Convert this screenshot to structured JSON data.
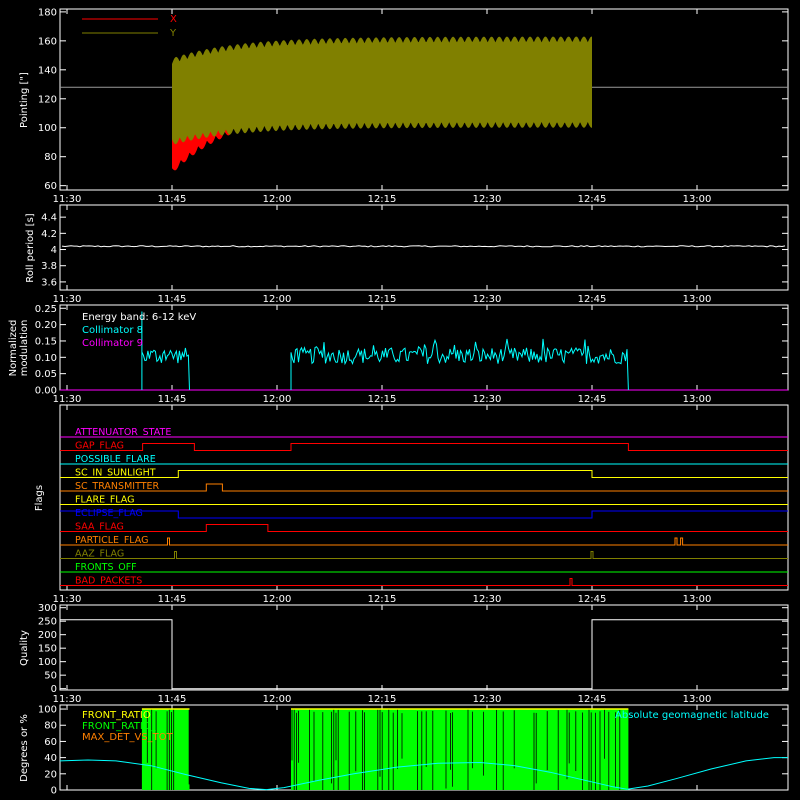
{
  "chart_data": [
    {
      "id": "pointing",
      "type": "line",
      "ylabel": "Pointing [\"]",
      "ylim": [
        57,
        182
      ],
      "yticks": [
        60,
        80,
        100,
        120,
        140,
        160,
        180
      ],
      "x_ticks": [
        "11:30",
        "11:45",
        "12:00",
        "12:15",
        "12:30",
        "12:45",
        "13:00"
      ],
      "x_tick_minutes": [
        690,
        705,
        720,
        735,
        750,
        765,
        780
      ],
      "x_range_minutes": [
        689,
        793
      ],
      "legend": {
        "placement": "top-left"
      },
      "reference_line": 128,
      "series": [
        {
          "name": "X",
          "color": "#ff0000",
          "start": 705.0,
          "end": 765.0,
          "start_range": [
            68,
            145
          ],
          "settled_range": [
            113,
            158
          ]
        },
        {
          "name": "Y",
          "color": "#808000",
          "start": 705.0,
          "end": 765.0,
          "start_range": [
            88,
            148
          ],
          "settled_range": [
            100,
            163
          ]
        }
      ]
    },
    {
      "id": "roll-period",
      "type": "line",
      "ylabel": "Roll period [s]",
      "ylim": [
        3.5,
        4.55
      ],
      "yticks": [
        3.6,
        3.8,
        4.0,
        4.2,
        4.4
      ],
      "x_ticks": [
        "11:30",
        "11:45",
        "12:00",
        "12:15",
        "12:30",
        "12:45",
        "13:00"
      ],
      "series": [
        {
          "name": "",
          "color": "#ffffff",
          "value": 4.04
        }
      ]
    },
    {
      "id": "modulation",
      "type": "line",
      "ylabel_lines": [
        "Normalized",
        "modulation"
      ],
      "ylim": [
        0,
        0.26
      ],
      "yticks": [
        0.0,
        0.05,
        0.1,
        0.15,
        0.2,
        0.25
      ],
      "ytick_labels": [
        "0.00",
        "0.05",
        "0.10",
        "0.15",
        "0.20",
        "0.25"
      ],
      "x_ticks": [
        "11:30",
        "11:45",
        "12:00",
        "12:15",
        "12:30",
        "12:45",
        "13:00"
      ],
      "annotation": "Energy band: 6-12 keV",
      "series": [
        {
          "name": "Collimator 8",
          "color": "#00ffff",
          "segments": [
            [
              700.7,
              707.5
            ],
            [
              722.0,
              770.2
            ]
          ],
          "level": 0.105
        },
        {
          "name": "Collimator 9",
          "color": "#ff00ff",
          "value": 0.0
        }
      ]
    },
    {
      "id": "flags",
      "type": "line",
      "ylabel": "Flags",
      "x_ticks": [
        "11:30",
        "11:45",
        "12:00",
        "12:15",
        "12:30",
        "12:45",
        "13:00"
      ],
      "series": [
        {
          "name": "ATTENUATOR_STATE",
          "color": "#ff00ff",
          "steps": [
            [
              689,
              0
            ]
          ]
        },
        {
          "name": "GAP_FLAG",
          "color": "#ff0000",
          "steps": [
            [
              689,
              0
            ],
            [
              700.8,
              1
            ],
            [
              708.2,
              0
            ],
            [
              722.0,
              1
            ],
            [
              770.2,
              0
            ]
          ]
        },
        {
          "name": "POSSIBLE_FLARE",
          "color": "#00ffff",
          "steps": [
            [
              689,
              0
            ]
          ]
        },
        {
          "name": "SC_IN_SUNLIGHT",
          "color": "#ffff00",
          "steps": [
            [
              689,
              0
            ],
            [
              705.9,
              1
            ],
            [
              765.0,
              0
            ]
          ]
        },
        {
          "name": "SC_TRANSMITTER",
          "color": "#ff8000",
          "steps": [
            [
              689,
              0
            ],
            [
              709.9,
              1
            ],
            [
              712.2,
              0
            ]
          ]
        },
        {
          "name": "FLARE_FLAG",
          "color": "#ffff00",
          "steps": [
            [
              689,
              0
            ]
          ]
        },
        {
          "name": "ECLIPSE_FLAG",
          "color": "#0000ff",
          "steps": [
            [
              689,
              1
            ],
            [
              705.9,
              0
            ],
            [
              765.0,
              1
            ]
          ]
        },
        {
          "name": "SAA_FLAG",
          "color": "#ff0000",
          "steps": [
            [
              689,
              0
            ],
            [
              709.9,
              1
            ],
            [
              718.7,
              0
            ]
          ]
        },
        {
          "name": "PARTICLE_FLAG",
          "color": "#ff8000",
          "spikes": [
            704.5,
            777.0,
            777.8
          ]
        },
        {
          "name": "AAZ_FLAG",
          "color": "#808000",
          "spikes": [
            705.5,
            765.0
          ]
        },
        {
          "name": "FRONTS_OFF",
          "color": "#00ff00",
          "steps": [
            [
              689,
              0
            ]
          ]
        },
        {
          "name": "BAD_PACKETS",
          "color": "#ff0000",
          "spikes": [
            762.0
          ]
        }
      ]
    },
    {
      "id": "quality",
      "type": "line",
      "ylabel": "Quality",
      "ylim": [
        -5,
        310
      ],
      "yticks": [
        0,
        50,
        100,
        150,
        200,
        250,
        300
      ],
      "x_ticks": [
        "11:30",
        "11:45",
        "12:00",
        "12:15",
        "12:30",
        "12:45",
        "13:00"
      ],
      "series": [
        {
          "name": "",
          "color": "#ffffff",
          "steps": [
            [
              689,
              255
            ],
            [
              705.0,
              0
            ],
            [
              765.0,
              255
            ]
          ]
        }
      ]
    },
    {
      "id": "ratios",
      "type": "line",
      "ylabel": "Degrees or %",
      "ylim": [
        0,
        105
      ],
      "yticks": [
        0,
        20,
        40,
        60,
        80,
        100
      ],
      "series": [
        {
          "name": "FRONT_RATIO",
          "color": "#ffff00"
        },
        {
          "name": "FRONT_RATIO_",
          "color": "#00ff00",
          "segments": [
            [
              700.7,
              707.5
            ],
            [
              722.0,
              770.2
            ]
          ]
        },
        {
          "name": "MAX_DET_VS_TOT",
          "color": "#ff8000"
        },
        {
          "name": "Absolute geomagnetic latitude",
          "color": "#00ffff",
          "points": [
            [
              689,
              36
            ],
            [
              693,
              37
            ],
            [
              697,
              36
            ],
            [
              702,
              30
            ],
            [
              707,
              19
            ],
            [
              712,
              9
            ],
            [
              716,
              2
            ],
            [
              718.5,
              0.5
            ],
            [
              721,
              3
            ],
            [
              726,
              12
            ],
            [
              731,
              20
            ],
            [
              737,
              28
            ],
            [
              743,
              33
            ],
            [
              749,
              34
            ],
            [
              754,
              30
            ],
            [
              759,
              22
            ],
            [
              764,
              12
            ],
            [
              768,
              4
            ],
            [
              770,
              1
            ],
            [
              773,
              5
            ],
            [
              777,
              14
            ],
            [
              782,
              26
            ],
            [
              787,
              36
            ],
            [
              791,
              40
            ],
            [
              793,
              40
            ]
          ]
        }
      ]
    }
  ]
}
